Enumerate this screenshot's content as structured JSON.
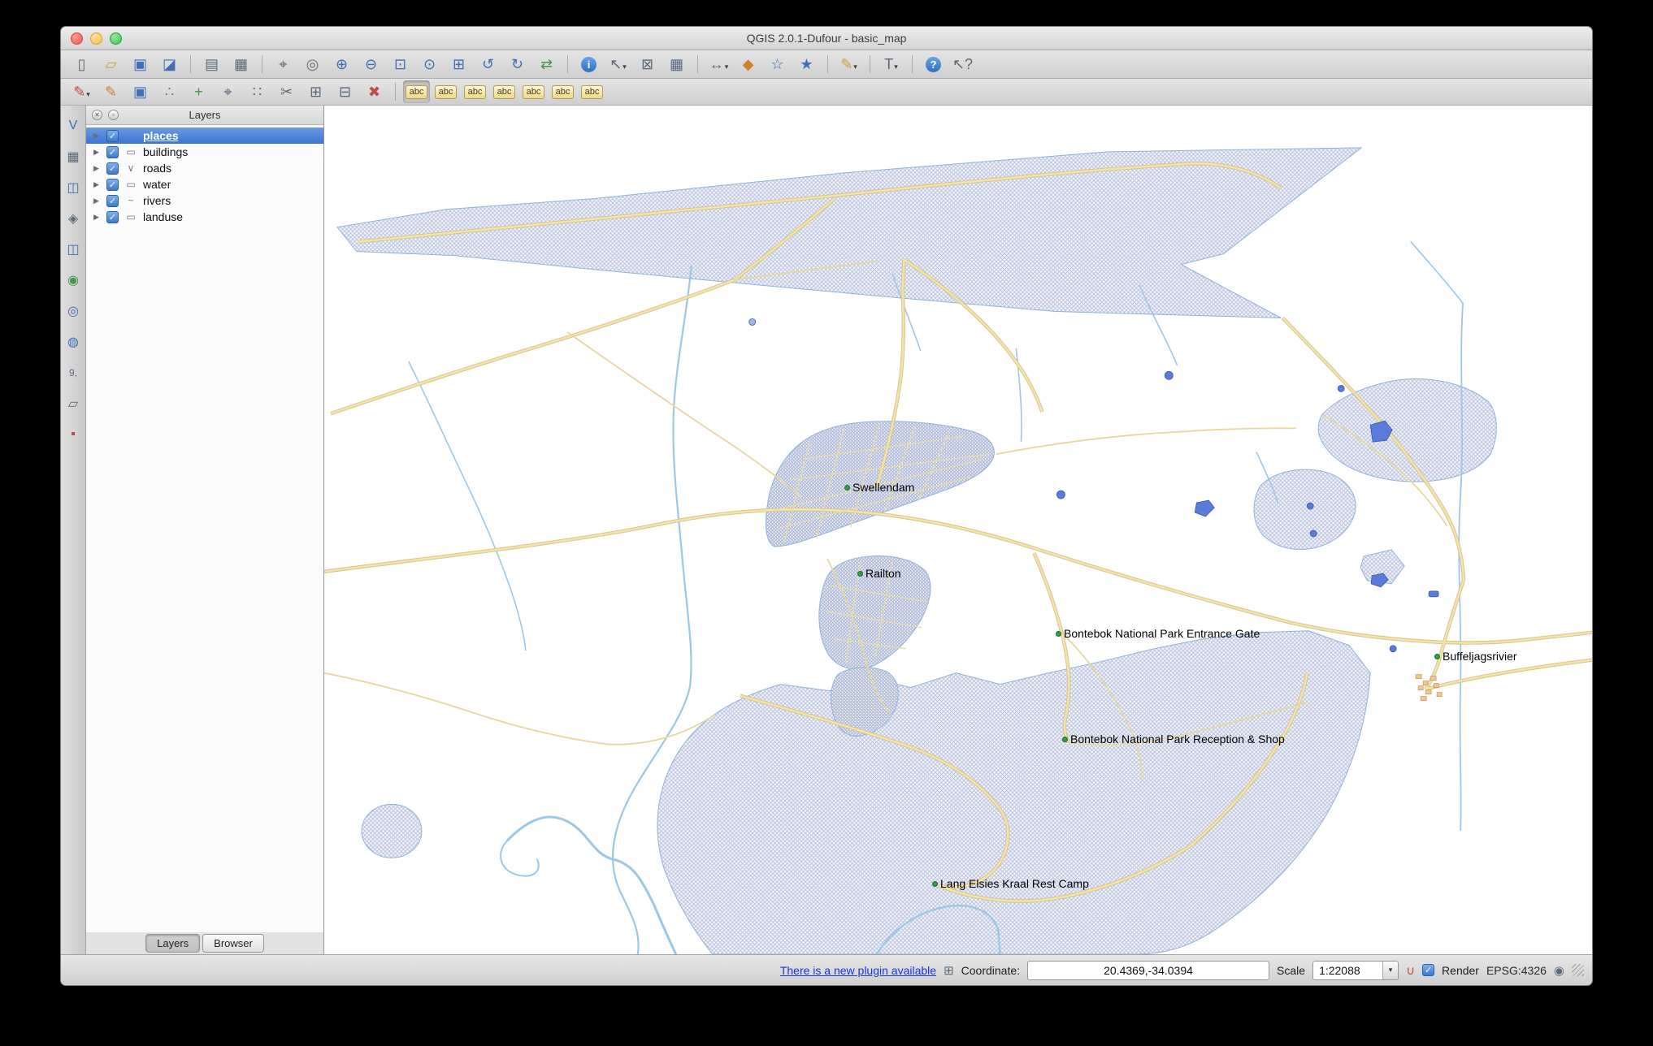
{
  "window": {
    "title": "QGIS 2.0.1-Dufour - basic_map"
  },
  "icons": {
    "check": "✓",
    "expand_arrow": "▶",
    "dropdown_arrow": "▾",
    "close": "✕",
    "float_panel": "▫",
    "plugin": "⊞",
    "scale_magnet": "∪",
    "crs_globe": "◉",
    "log_messages": "▤"
  },
  "toolbar_main": {
    "buttons": [
      {
        "name": "new-project",
        "glyph": "▯"
      },
      {
        "name": "open-project",
        "glyph": "▱"
      },
      {
        "name": "save-project",
        "glyph": "▣"
      },
      {
        "name": "save-project-as",
        "glyph": "◪"
      },
      {
        "name": "new-print-composer",
        "glyph": "▤"
      },
      {
        "name": "composer-manager",
        "glyph": "▦"
      },
      {
        "name": "pan-map",
        "glyph": "⌖"
      },
      {
        "name": "pan-to-selection",
        "glyph": "◎"
      },
      {
        "name": "zoom-in",
        "glyph": "⊕"
      },
      {
        "name": "zoom-out",
        "glyph": "⊖"
      },
      {
        "name": "zoom-full",
        "glyph": "⊡"
      },
      {
        "name": "zoom-to-selection",
        "glyph": "⊙"
      },
      {
        "name": "zoom-to-layer",
        "glyph": "⊞"
      },
      {
        "name": "zoom-last",
        "glyph": "↺"
      },
      {
        "name": "zoom-next",
        "glyph": "↻"
      },
      {
        "name": "refresh",
        "glyph": "⇄"
      },
      {
        "name": "identify-features",
        "glyph": "i"
      },
      {
        "name": "select-features",
        "glyph": "↖"
      },
      {
        "name": "deselect-features",
        "glyph": "⊠"
      },
      {
        "name": "open-attribute-table",
        "glyph": "▦"
      },
      {
        "name": "measure",
        "glyph": "↔"
      },
      {
        "name": "map-tips",
        "glyph": "◆"
      },
      {
        "name": "new-bookmark",
        "glyph": "☆"
      },
      {
        "name": "show-bookmarks",
        "glyph": "★"
      },
      {
        "name": "annotation",
        "glyph": "✎"
      },
      {
        "name": "text-annotation",
        "glyph": "T"
      },
      {
        "name": "help",
        "glyph": "?"
      },
      {
        "name": "whats-this",
        "glyph": "↖?"
      }
    ]
  },
  "toolbar_edit": {
    "buttons": [
      {
        "name": "current-edits",
        "glyph": "✎"
      },
      {
        "name": "toggle-editing",
        "glyph": "✎"
      },
      {
        "name": "save-layer-edits",
        "glyph": "▣"
      },
      {
        "name": "digitize-segment",
        "glyph": "∴"
      },
      {
        "name": "add-feature",
        "glyph": "+"
      },
      {
        "name": "move-feature",
        "glyph": "⌖"
      },
      {
        "name": "node-tool",
        "glyph": "∷"
      },
      {
        "name": "cut-features",
        "glyph": "✂"
      },
      {
        "name": "copy-features",
        "glyph": "⊞"
      },
      {
        "name": "paste-features",
        "glyph": "⊟"
      },
      {
        "name": "delete-selected",
        "glyph": "✖"
      },
      {
        "name": "labeling-options",
        "text": "abc"
      },
      {
        "name": "new-label",
        "text": "abc"
      },
      {
        "name": "pin-labels",
        "text": "abc"
      },
      {
        "name": "highlight-labels",
        "text": "abc"
      },
      {
        "name": "move-label",
        "text": "abc"
      },
      {
        "name": "rotate-label",
        "text": "abc"
      },
      {
        "name": "label-properties",
        "text": "abc"
      }
    ]
  },
  "left_toolbar": {
    "buttons": [
      {
        "name": "add-vector-layer",
        "glyph": "V"
      },
      {
        "name": "add-raster-layer",
        "glyph": "▦"
      },
      {
        "name": "add-postgis-layer",
        "glyph": "◫"
      },
      {
        "name": "add-spatialite-layer",
        "glyph": "◈"
      },
      {
        "name": "add-mssql-layer",
        "glyph": "◫"
      },
      {
        "name": "add-wms-layer",
        "glyph": "◉"
      },
      {
        "name": "add-wcs-layer",
        "glyph": "◎"
      },
      {
        "name": "add-wfs-layer",
        "glyph": "◍"
      },
      {
        "name": "add-delimited-text-layer",
        "glyph": "9,"
      },
      {
        "name": "new-shapefile-layer",
        "glyph": "▱"
      },
      {
        "name": "remove-layer-group",
        "glyph": "▪"
      }
    ]
  },
  "layers_panel": {
    "title": "Layers",
    "items": [
      {
        "label": "places",
        "icon_glyph": "∴",
        "checked": true,
        "selected": true
      },
      {
        "label": "buildings",
        "icon_glyph": "▭",
        "checked": true,
        "selected": false
      },
      {
        "label": "roads",
        "icon_glyph": "∨",
        "checked": true,
        "selected": false
      },
      {
        "label": "water",
        "icon_glyph": "▭",
        "checked": true,
        "selected": false
      },
      {
        "label": "rivers",
        "icon_glyph": "~",
        "checked": true,
        "selected": false
      },
      {
        "label": "landuse",
        "icon_glyph": "▭",
        "checked": true,
        "selected": false
      }
    ],
    "tabs": [
      {
        "label": "Layers"
      },
      {
        "label": "Browser"
      }
    ]
  },
  "map": {
    "labels": [
      {
        "text": "Swellendam"
      },
      {
        "text": "Railton"
      },
      {
        "text": "Bontebok National Park Entrance Gate"
      },
      {
        "text": "Buffeljagsrivier"
      },
      {
        "text": "Bontebok National Park Reception & Shop"
      },
      {
        "text": "Lang Elsies Kraal Rest Camp"
      }
    ]
  },
  "status_bar": {
    "plugin_link": "There is a new plugin available",
    "coordinate_label": "Coordinate:",
    "coordinate_value": "20.4369,-34.0394",
    "scale_label": "Scale",
    "scale_value": "1:22088",
    "render_label": "Render",
    "crs_text": "EPSG:4326"
  },
  "colors": {
    "landuse_hatch": "#b3bddc",
    "road_major": "#f0e3ac",
    "road_casing": "#d8c187",
    "river": "#9cc8e8",
    "water_fill": "#5b7bd9",
    "place_marker": "#2f9e44",
    "selection_blue": "#3c74d2",
    "link_blue": "#1a35d6"
  }
}
